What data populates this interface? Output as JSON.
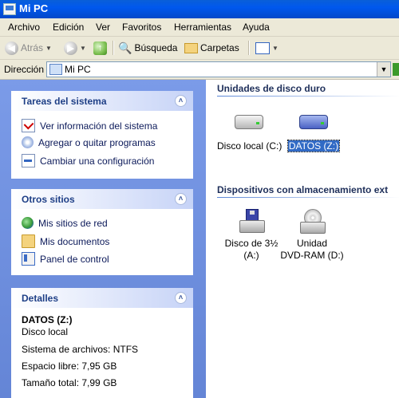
{
  "window": {
    "title": "Mi PC"
  },
  "menu": [
    "Archivo",
    "Edición",
    "Ver",
    "Favoritos",
    "Herramientas",
    "Ayuda"
  ],
  "toolbar": {
    "back_label": "Atrás",
    "search_label": "Búsqueda",
    "folders_label": "Carpetas"
  },
  "address": {
    "label": "Dirección",
    "value": "Mi PC"
  },
  "system_tasks": {
    "title": "Tareas del sistema",
    "items": [
      "Ver información del sistema",
      "Agregar o quitar programas",
      "Cambiar una configuración"
    ]
  },
  "other_places": {
    "title": "Otros sitios",
    "items": [
      "Mis sitios de red",
      "Mis documentos",
      "Panel de control"
    ]
  },
  "details": {
    "title": "Detalles",
    "name": "DATOS (Z:)",
    "type": "Disco local",
    "filesystem": "Sistema de archivos: NTFS",
    "free": "Espacio libre: 7,95 GB",
    "total": "Tamaño total: 7,99 GB"
  },
  "hard_drives": {
    "title": "Unidades de disco duro",
    "items": [
      {
        "label": "Disco local (C:)",
        "icon": "hard-drive-icon",
        "selected": false
      },
      {
        "label": "DATOS (Z:)",
        "icon": "hard-drive-blue-icon",
        "selected": true
      }
    ]
  },
  "removable": {
    "title": "Dispositivos con almacenamiento ext",
    "items": [
      {
        "line1": "Disco de 3½",
        "line2": "(A:)",
        "icon": "floppy-drive-icon"
      },
      {
        "line1": "Unidad",
        "line2": "DVD-RAM (D:)",
        "icon": "dvd-drive-icon"
      }
    ]
  }
}
